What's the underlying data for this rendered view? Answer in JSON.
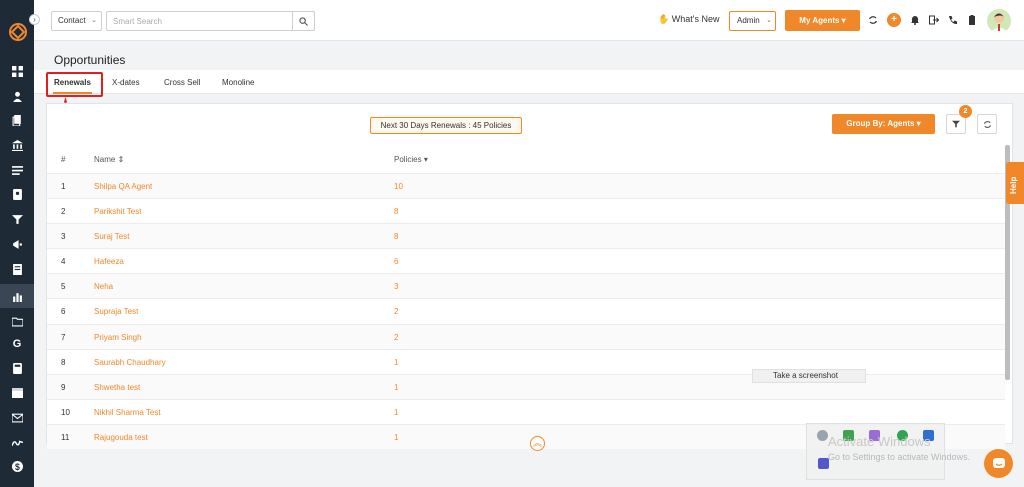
{
  "header": {
    "contact_select": "Contact",
    "search_placeholder": "Smart Search",
    "whats_new": "What's New",
    "admin_select": "Admin",
    "my_agents": "My Agents"
  },
  "page": {
    "title": "Opportunities",
    "tabs": [
      {
        "label": "Renewals"
      },
      {
        "label": "X-dates"
      },
      {
        "label": "Cross Sell"
      },
      {
        "label": "Monoline"
      }
    ]
  },
  "toolbar": {
    "summary": "Next 30 Days Renewals : 45 Policies",
    "group_by": "Group By: Agents",
    "filter_count": "2"
  },
  "table": {
    "headers": {
      "num": "#",
      "name": "Name",
      "policies": "Policies"
    },
    "rows": [
      {
        "num": "1",
        "name": "Shilpa QA Agent",
        "policies": "10"
      },
      {
        "num": "2",
        "name": "Parikshit Test",
        "policies": "8"
      },
      {
        "num": "3",
        "name": "Suraj Test",
        "policies": "8"
      },
      {
        "num": "4",
        "name": "Hafeeza",
        "policies": "6"
      },
      {
        "num": "5",
        "name": "Neha",
        "policies": "3"
      },
      {
        "num": "6",
        "name": "Supraja Test",
        "policies": "2"
      },
      {
        "num": "7",
        "name": "Priyam Singh",
        "policies": "2"
      },
      {
        "num": "8",
        "name": "Saurabh Chaudhary",
        "policies": "1"
      },
      {
        "num": "9",
        "name": "Shwetha test",
        "policies": "1"
      },
      {
        "num": "10",
        "name": "Nikhil Sharma Test",
        "policies": "1"
      },
      {
        "num": "11",
        "name": "Rajugouda test",
        "policies": "1"
      }
    ]
  },
  "overlay": {
    "screenshot_tooltip": "Take a screenshot",
    "help": "Help",
    "activate_title": "Activate Windows",
    "activate_sub": "Go to Settings to activate Windows."
  },
  "colors": {
    "accent": "#f0882a",
    "sidebar": "#1f2a37",
    "annotation": "#e02020"
  }
}
